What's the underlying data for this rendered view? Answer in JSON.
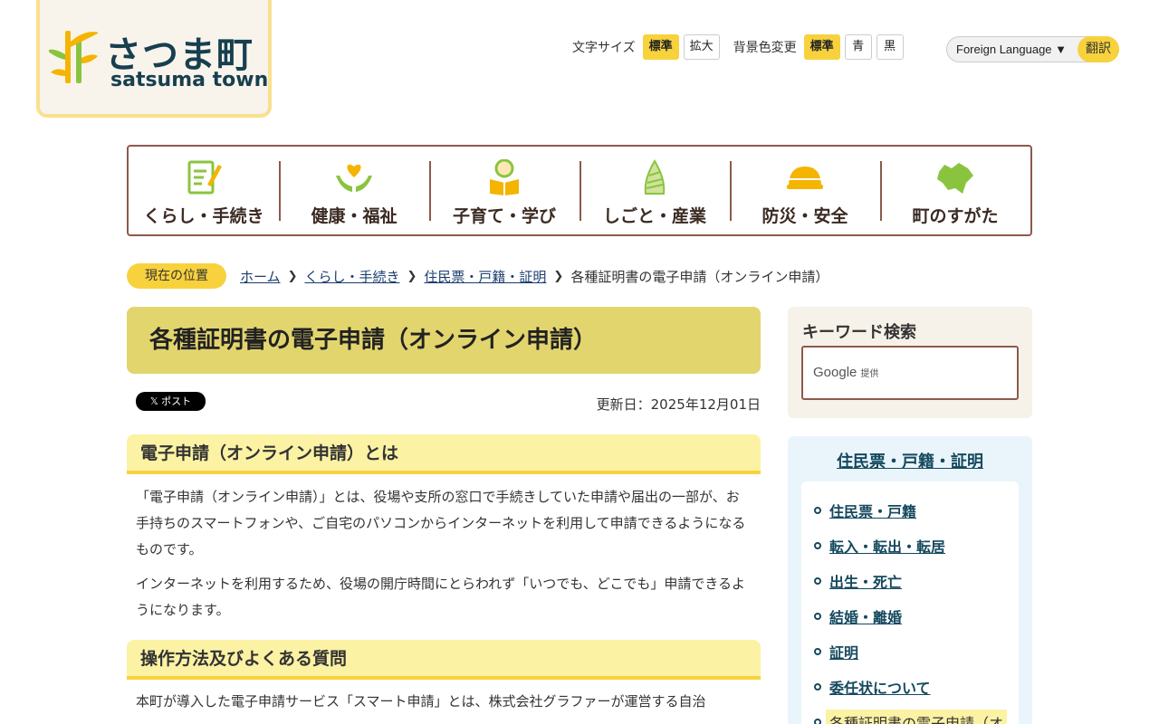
{
  "logo": {
    "jp": "さつま町",
    "en": "satsuma town"
  },
  "tools": {
    "font_size_label": "文字サイズ",
    "font_standard": "標準",
    "font_large": "拡大",
    "bg_label": "背景色変更",
    "bg_standard": "標準",
    "bg_blue": "青",
    "bg_black": "黒"
  },
  "language": {
    "select_label": "Foreign Language",
    "translate_label": "翻訳"
  },
  "nav": [
    {
      "label": "くらし・手続き",
      "icon": "document-pen-icon"
    },
    {
      "label": "健康・福祉",
      "icon": "heart-hands-icon"
    },
    {
      "label": "子育て・学び",
      "icon": "child-book-icon"
    },
    {
      "label": "しごと・産業",
      "icon": "bamboo-shoot-icon"
    },
    {
      "label": "防災・安全",
      "icon": "helmet-icon"
    },
    {
      "label": "町のすがた",
      "icon": "town-map-icon"
    }
  ],
  "breadcrumb": {
    "tag": "現在の位置",
    "links": [
      "ホーム",
      "くらし・手続き",
      "住民票・戸籍・証明"
    ],
    "current": "各種証明書の電子申請（オンライン申請）"
  },
  "page": {
    "title": "各種証明書の電子申請（オンライン申請）",
    "post_label": "𝕏 ポスト",
    "updated": "更新日：2025年12月01日"
  },
  "sections": [
    {
      "heading": "電子申請（オンライン申請）とは",
      "paragraphs": [
        "「電子申請（オンライン申請）」とは、役場や支所の窓口で手続きしていた申請や届出の一部が、お手持ちのスマートフォンや、ご自宅のパソコンからインターネットを利用して申請できるようになるものです。",
        "インターネットを利用するため、役場の開庁時間にとらわれず「いつでも、どこでも」申請できるようになります。"
      ]
    },
    {
      "heading": "操作方法及びよくある質問",
      "paragraphs": [
        "本町が導入した電子申請サービス「スマート申請」とは、株式会社グラファーが運営する自治"
      ]
    }
  ],
  "sidebar": {
    "keyword_title": "キーワード検索",
    "google_label": "Google",
    "google_sub": "提供",
    "section_title": "住民票・戸籍・証明",
    "items": [
      "住民票・戸籍",
      "転入・転出・転居",
      "出生・死亡",
      "結婚・離婚",
      "証明",
      "委任状について",
      "各種証明書の電子申請（オ"
    ]
  },
  "colors": {
    "accent_yellow": "#f7d23d",
    "title_band": "#e2d56e",
    "nav_border": "#8c5a4c",
    "link": "#15495e"
  }
}
